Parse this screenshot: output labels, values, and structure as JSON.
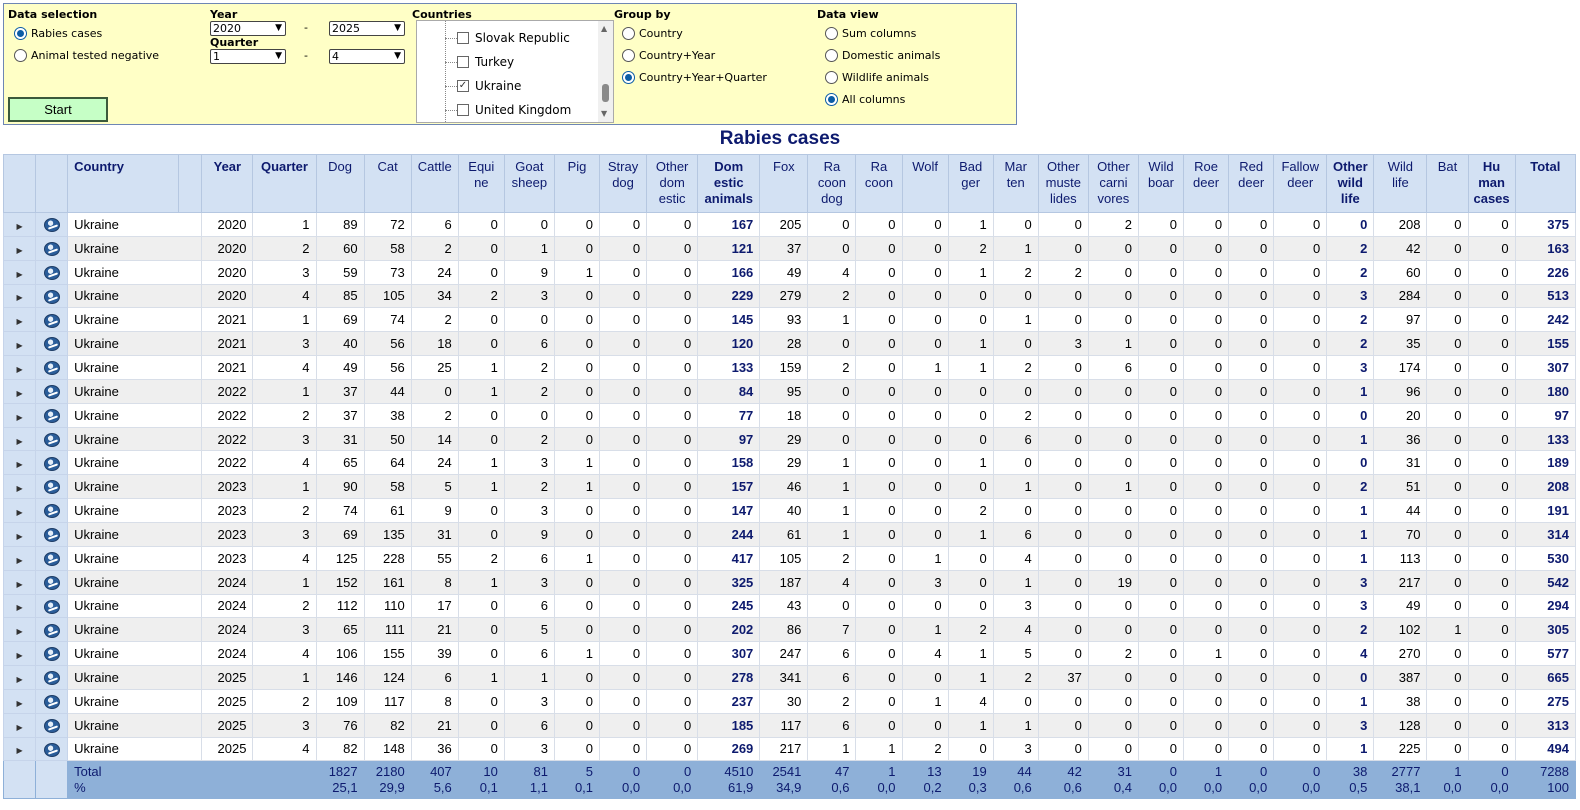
{
  "panel": {
    "data_selection": {
      "title": "Data selection",
      "options": [
        {
          "label": "Rabies cases",
          "selected": true
        },
        {
          "label": "Animal tested negative",
          "selected": false
        }
      ]
    },
    "year": {
      "title": "Year",
      "from": "2020",
      "to": "2025",
      "separator": "-"
    },
    "quarter": {
      "title": "Quarter",
      "from": "1",
      "to": "4",
      "separator": "-"
    },
    "start_label": "Start",
    "countries": {
      "title": "Countries",
      "items": [
        {
          "label": "Slovak Republic",
          "checked": false
        },
        {
          "label": "Turkey",
          "checked": false
        },
        {
          "label": "Ukraine",
          "checked": true
        },
        {
          "label": "United Kingdom",
          "checked": false
        }
      ]
    },
    "group_by": {
      "title": "Group by",
      "options": [
        {
          "label": "Country",
          "selected": false
        },
        {
          "label": "Country+Year",
          "selected": false
        },
        {
          "label": "Country+Year+Quarter",
          "selected": true
        }
      ]
    },
    "data_view": {
      "title": "Data view",
      "options": [
        {
          "label": "Sum columns",
          "selected": false
        },
        {
          "label": "Domestic animals",
          "selected": false
        },
        {
          "label": "Wildlife animals",
          "selected": false
        },
        {
          "label": "All columns",
          "selected": true
        }
      ]
    }
  },
  "title": "Rabies cases",
  "table": {
    "headers": [
      "Country",
      "Year",
      "Quarter",
      "Dog",
      "Cat",
      "Cattle",
      "Equi\nne",
      "Goat\nsheep",
      "Pig",
      "Stray\ndog",
      "Other\ndom\nestic",
      "Dom\nestic\nanimals",
      "Fox",
      "Ra\ncoon\ndog",
      "Ra\ncoon",
      "Wolf",
      "Bad\nger",
      "Mar\nten",
      "Other\nmuste\nlides",
      "Other\ncarni\nvores",
      "Wild\nboar",
      "Roe\ndeer",
      "Red\ndeer",
      "Fallow\ndeer",
      "Other\nwild\nlife",
      "Wild\nlife",
      "Bat",
      "Hu\nman\ncases",
      "Total"
    ],
    "rows": [
      [
        "Ukraine",
        "2020",
        "1",
        "89",
        "72",
        "6",
        "0",
        "0",
        "0",
        "0",
        "0",
        "167",
        "205",
        "0",
        "0",
        "0",
        "1",
        "0",
        "0",
        "2",
        "0",
        "0",
        "0",
        "0",
        "0",
        "208",
        "0",
        "0",
        "375"
      ],
      [
        "Ukraine",
        "2020",
        "2",
        "60",
        "58",
        "2",
        "0",
        "1",
        "0",
        "0",
        "0",
        "121",
        "37",
        "0",
        "0",
        "0",
        "2",
        "1",
        "0",
        "0",
        "0",
        "0",
        "0",
        "0",
        "2",
        "42",
        "0",
        "0",
        "163"
      ],
      [
        "Ukraine",
        "2020",
        "3",
        "59",
        "73",
        "24",
        "0",
        "9",
        "1",
        "0",
        "0",
        "166",
        "49",
        "4",
        "0",
        "0",
        "1",
        "2",
        "2",
        "0",
        "0",
        "0",
        "0",
        "0",
        "2",
        "60",
        "0",
        "0",
        "226"
      ],
      [
        "Ukraine",
        "2020",
        "4",
        "85",
        "105",
        "34",
        "2",
        "3",
        "0",
        "0",
        "0",
        "229",
        "279",
        "2",
        "0",
        "0",
        "0",
        "0",
        "0",
        "0",
        "0",
        "0",
        "0",
        "0",
        "3",
        "284",
        "0",
        "0",
        "513"
      ],
      [
        "Ukraine",
        "2021",
        "1",
        "69",
        "74",
        "2",
        "0",
        "0",
        "0",
        "0",
        "0",
        "145",
        "93",
        "1",
        "0",
        "0",
        "0",
        "1",
        "0",
        "0",
        "0",
        "0",
        "0",
        "0",
        "2",
        "97",
        "0",
        "0",
        "242"
      ],
      [
        "Ukraine",
        "2021",
        "3",
        "40",
        "56",
        "18",
        "0",
        "6",
        "0",
        "0",
        "0",
        "120",
        "28",
        "0",
        "0",
        "0",
        "1",
        "0",
        "3",
        "1",
        "0",
        "0",
        "0",
        "0",
        "2",
        "35",
        "0",
        "0",
        "155"
      ],
      [
        "Ukraine",
        "2021",
        "4",
        "49",
        "56",
        "25",
        "1",
        "2",
        "0",
        "0",
        "0",
        "133",
        "159",
        "2",
        "0",
        "1",
        "1",
        "2",
        "0",
        "6",
        "0",
        "0",
        "0",
        "0",
        "3",
        "174",
        "0",
        "0",
        "307"
      ],
      [
        "Ukraine",
        "2022",
        "1",
        "37",
        "44",
        "0",
        "1",
        "2",
        "0",
        "0",
        "0",
        "84",
        "95",
        "0",
        "0",
        "0",
        "0",
        "0",
        "0",
        "0",
        "0",
        "0",
        "0",
        "0",
        "1",
        "96",
        "0",
        "0",
        "180"
      ],
      [
        "Ukraine",
        "2022",
        "2",
        "37",
        "38",
        "2",
        "0",
        "0",
        "0",
        "0",
        "0",
        "77",
        "18",
        "0",
        "0",
        "0",
        "0",
        "2",
        "0",
        "0",
        "0",
        "0",
        "0",
        "0",
        "0",
        "20",
        "0",
        "0",
        "97"
      ],
      [
        "Ukraine",
        "2022",
        "3",
        "31",
        "50",
        "14",
        "0",
        "2",
        "0",
        "0",
        "0",
        "97",
        "29",
        "0",
        "0",
        "0",
        "0",
        "6",
        "0",
        "0",
        "0",
        "0",
        "0",
        "0",
        "1",
        "36",
        "0",
        "0",
        "133"
      ],
      [
        "Ukraine",
        "2022",
        "4",
        "65",
        "64",
        "24",
        "1",
        "3",
        "1",
        "0",
        "0",
        "158",
        "29",
        "1",
        "0",
        "0",
        "1",
        "0",
        "0",
        "0",
        "0",
        "0",
        "0",
        "0",
        "0",
        "31",
        "0",
        "0",
        "189"
      ],
      [
        "Ukraine",
        "2023",
        "1",
        "90",
        "58",
        "5",
        "1",
        "2",
        "1",
        "0",
        "0",
        "157",
        "46",
        "1",
        "0",
        "0",
        "0",
        "1",
        "0",
        "1",
        "0",
        "0",
        "0",
        "0",
        "2",
        "51",
        "0",
        "0",
        "208"
      ],
      [
        "Ukraine",
        "2023",
        "2",
        "74",
        "61",
        "9",
        "0",
        "3",
        "0",
        "0",
        "0",
        "147",
        "40",
        "1",
        "0",
        "0",
        "2",
        "0",
        "0",
        "0",
        "0",
        "0",
        "0",
        "0",
        "1",
        "44",
        "0",
        "0",
        "191"
      ],
      [
        "Ukraine",
        "2023",
        "3",
        "69",
        "135",
        "31",
        "0",
        "9",
        "0",
        "0",
        "0",
        "244",
        "61",
        "1",
        "0",
        "0",
        "1",
        "6",
        "0",
        "0",
        "0",
        "0",
        "0",
        "0",
        "1",
        "70",
        "0",
        "0",
        "314"
      ],
      [
        "Ukraine",
        "2023",
        "4",
        "125",
        "228",
        "55",
        "2",
        "6",
        "1",
        "0",
        "0",
        "417",
        "105",
        "2",
        "0",
        "1",
        "0",
        "4",
        "0",
        "0",
        "0",
        "0",
        "0",
        "0",
        "1",
        "113",
        "0",
        "0",
        "530"
      ],
      [
        "Ukraine",
        "2024",
        "1",
        "152",
        "161",
        "8",
        "1",
        "3",
        "0",
        "0",
        "0",
        "325",
        "187",
        "4",
        "0",
        "3",
        "0",
        "1",
        "0",
        "19",
        "0",
        "0",
        "0",
        "0",
        "3",
        "217",
        "0",
        "0",
        "542"
      ],
      [
        "Ukraine",
        "2024",
        "2",
        "112",
        "110",
        "17",
        "0",
        "6",
        "0",
        "0",
        "0",
        "245",
        "43",
        "0",
        "0",
        "0",
        "0",
        "3",
        "0",
        "0",
        "0",
        "0",
        "0",
        "0",
        "3",
        "49",
        "0",
        "0",
        "294"
      ],
      [
        "Ukraine",
        "2024",
        "3",
        "65",
        "111",
        "21",
        "0",
        "5",
        "0",
        "0",
        "0",
        "202",
        "86",
        "7",
        "0",
        "1",
        "2",
        "4",
        "0",
        "0",
        "0",
        "0",
        "0",
        "0",
        "2",
        "102",
        "1",
        "0",
        "305"
      ],
      [
        "Ukraine",
        "2024",
        "4",
        "106",
        "155",
        "39",
        "0",
        "6",
        "1",
        "0",
        "0",
        "307",
        "247",
        "6",
        "0",
        "4",
        "1",
        "5",
        "0",
        "2",
        "0",
        "1",
        "0",
        "0",
        "4",
        "270",
        "0",
        "0",
        "577"
      ],
      [
        "Ukraine",
        "2025",
        "1",
        "146",
        "124",
        "6",
        "1",
        "1",
        "0",
        "0",
        "0",
        "278",
        "341",
        "6",
        "0",
        "0",
        "1",
        "2",
        "37",
        "0",
        "0",
        "0",
        "0",
        "0",
        "0",
        "387",
        "0",
        "0",
        "665"
      ],
      [
        "Ukraine",
        "2025",
        "2",
        "109",
        "117",
        "8",
        "0",
        "3",
        "0",
        "0",
        "0",
        "237",
        "30",
        "2",
        "0",
        "1",
        "4",
        "0",
        "0",
        "0",
        "0",
        "0",
        "0",
        "0",
        "1",
        "38",
        "0",
        "0",
        "275"
      ],
      [
        "Ukraine",
        "2025",
        "3",
        "76",
        "82",
        "21",
        "0",
        "6",
        "0",
        "0",
        "0",
        "185",
        "117",
        "6",
        "0",
        "0",
        "1",
        "1",
        "0",
        "0",
        "0",
        "0",
        "0",
        "0",
        "3",
        "128",
        "0",
        "0",
        "313"
      ],
      [
        "Ukraine",
        "2025",
        "4",
        "82",
        "148",
        "36",
        "0",
        "3",
        "0",
        "0",
        "0",
        "269",
        "217",
        "1",
        "1",
        "2",
        "0",
        "3",
        "0",
        "0",
        "0",
        "0",
        "0",
        "0",
        "1",
        "225",
        "0",
        "0",
        "494"
      ]
    ],
    "footer": {
      "total_label": "Total",
      "percent_label": "%",
      "totals": [
        "1827",
        "2180",
        "407",
        "10",
        "81",
        "5",
        "0",
        "0",
        "4510",
        "2541",
        "47",
        "1",
        "13",
        "19",
        "44",
        "42",
        "31",
        "0",
        "1",
        "0",
        "0",
        "38",
        "2777",
        "1",
        "0",
        "7288"
      ],
      "percents": [
        "25,1",
        "29,9",
        "5,6",
        "0,1",
        "1,1",
        "0,1",
        "0,0",
        "0,0",
        "61,9",
        "34,9",
        "0,6",
        "0,0",
        "0,2",
        "0,3",
        "0,6",
        "0,6",
        "0,4",
        "0,0",
        "0,0",
        "0,0",
        "0,0",
        "0,5",
        "38,1",
        "0,0",
        "0,0",
        "100"
      ]
    }
  }
}
